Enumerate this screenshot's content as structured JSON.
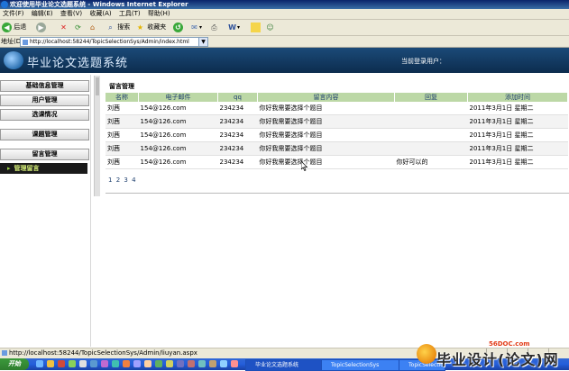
{
  "window": {
    "title": "欢迎使用毕业论文选题系统 - Windows Internet Explorer"
  },
  "menu": [
    "文件(F)",
    "编辑(E)",
    "查看(V)",
    "收藏(A)",
    "工具(T)",
    "帮助(H)"
  ],
  "toolbar": {
    "back": "后退",
    "search": "搜索",
    "favorites": "收藏夹"
  },
  "address": {
    "label": "地址(D)",
    "url": "http://localhost:58244/TopicSelectionSys/Admin/index.html"
  },
  "site": {
    "name": "毕业论文选题系统",
    "welcome": "当前登录用户："
  },
  "nav": {
    "items": [
      "基础信息管理",
      "用户管理",
      "选课情况",
      "课题管理",
      "留言管理"
    ],
    "active_sub": "管理留言"
  },
  "main": {
    "title": "留言管理",
    "columns": [
      "名称",
      "电子邮件",
      "qq",
      "留言内容",
      "回复",
      "添加时间"
    ],
    "rows": [
      [
        "刘茜",
        "154@126.com",
        "234234",
        "你好我需要选择个题目",
        "",
        "2011年3月1日 星期二"
      ],
      [
        "刘茜",
        "154@126.com",
        "234234",
        "你好我需要选择个题目",
        "",
        "2011年3月1日 星期二"
      ],
      [
        "刘茜",
        "154@126.com",
        "234234",
        "你好我需要选择个题目",
        "",
        "2011年3月1日 星期二"
      ],
      [
        "刘茜",
        "154@126.com",
        "234234",
        "你好我需要选择个题目",
        "",
        "2011年3月1日 星期二"
      ],
      [
        "刘茜",
        "154@126.com",
        "234234",
        "你好我需要选择个题目",
        "你好可以的",
        "2011年3月1日 星期二"
      ]
    ],
    "pages": [
      "1",
      "2",
      "3",
      "4"
    ]
  },
  "status": {
    "text": "http://localhost:58244/TopicSelectionSys/Admin/liuyan.aspx"
  },
  "taskbar": {
    "start": "开始",
    "tasks": [
      "毕业论文选题系统",
      "TopicSelectionSys",
      "TopicSelectionSys..."
    ]
  },
  "watermark": {
    "url": "56DOC.com",
    "text": "毕业设计(论文)网"
  }
}
